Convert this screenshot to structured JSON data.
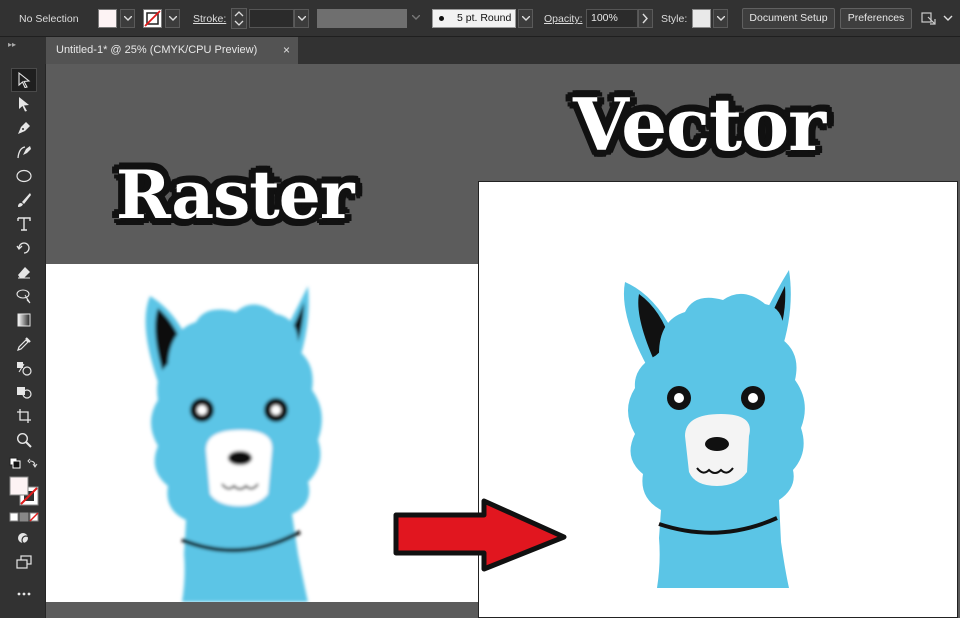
{
  "control_bar": {
    "selection_status": "No Selection",
    "stroke_label": "Stroke:",
    "brush_label": "5 pt. Round",
    "opacity_label": "Opacity:",
    "opacity_value": "100%",
    "style_label": "Style:",
    "document_setup_label": "Document Setup",
    "preferences_label": "Preferences",
    "fill_color": "#fdf3f4"
  },
  "document_tab": {
    "title": "Untitled-1* @ 25% (CMYK/CPU Preview)",
    "close_glyph": "×"
  },
  "tools": [
    "selection-tool-icon",
    "direct-selection-tool-icon",
    "pen-tool-icon",
    "curvature-tool-icon",
    "ellipse-tool-icon",
    "paintbrush-tool-icon",
    "type-tool-icon",
    "rotate-tool-icon",
    "eraser-tool-icon",
    "width-tool-icon",
    "gradient-tool-icon",
    "eyedropper-tool-icon",
    "blend-tool-icon",
    "shape-builder-tool-icon",
    "artboard-tool-icon",
    "zoom-tool-icon"
  ],
  "canvas": {
    "raster_title": "Raster",
    "vector_title": "Vector"
  },
  "colors": {
    "llama_blue": "#5bc5e6",
    "arrow_red": "#e1161f",
    "ui_dark": "#323232",
    "canvas_gray": "#5c5c5c"
  }
}
